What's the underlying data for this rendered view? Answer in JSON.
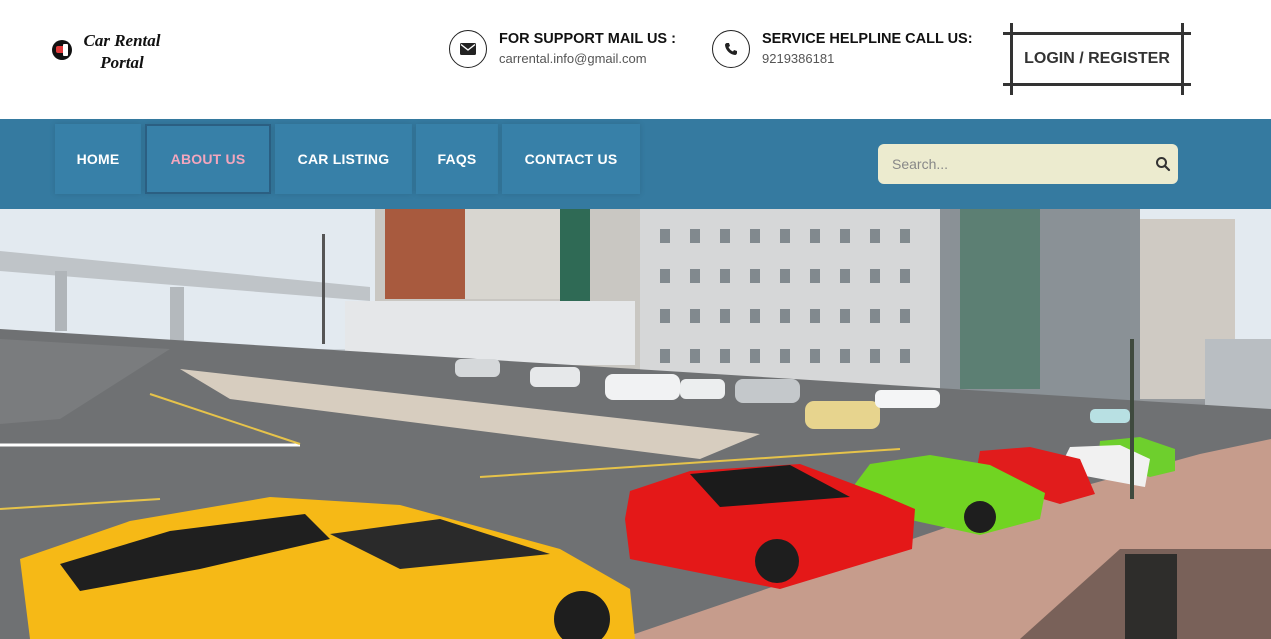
{
  "logo": {
    "line1": "Car Rental",
    "line2": "Portal"
  },
  "support": {
    "title": "FOR SUPPORT MAIL US :",
    "value": "carrental.info@gmail.com"
  },
  "helpline": {
    "title": "SERVICE HELPLINE CALL US:",
    "value": "9219386181"
  },
  "login_label": "LOGIN / REGISTER",
  "nav": {
    "items": [
      {
        "label": "HOME"
      },
      {
        "label": "ABOUT US",
        "active": true
      },
      {
        "label": "CAR LISTING"
      },
      {
        "label": "FAQS"
      },
      {
        "label": "CONTACT US"
      }
    ]
  },
  "search": {
    "placeholder": "Search..."
  },
  "colors": {
    "nav_bg": "#357aa0",
    "active_nav_text": "#f3a6bd",
    "search_bg": "#ecebcf"
  },
  "hero": {
    "alt": "hero-banner-sports-cars"
  }
}
